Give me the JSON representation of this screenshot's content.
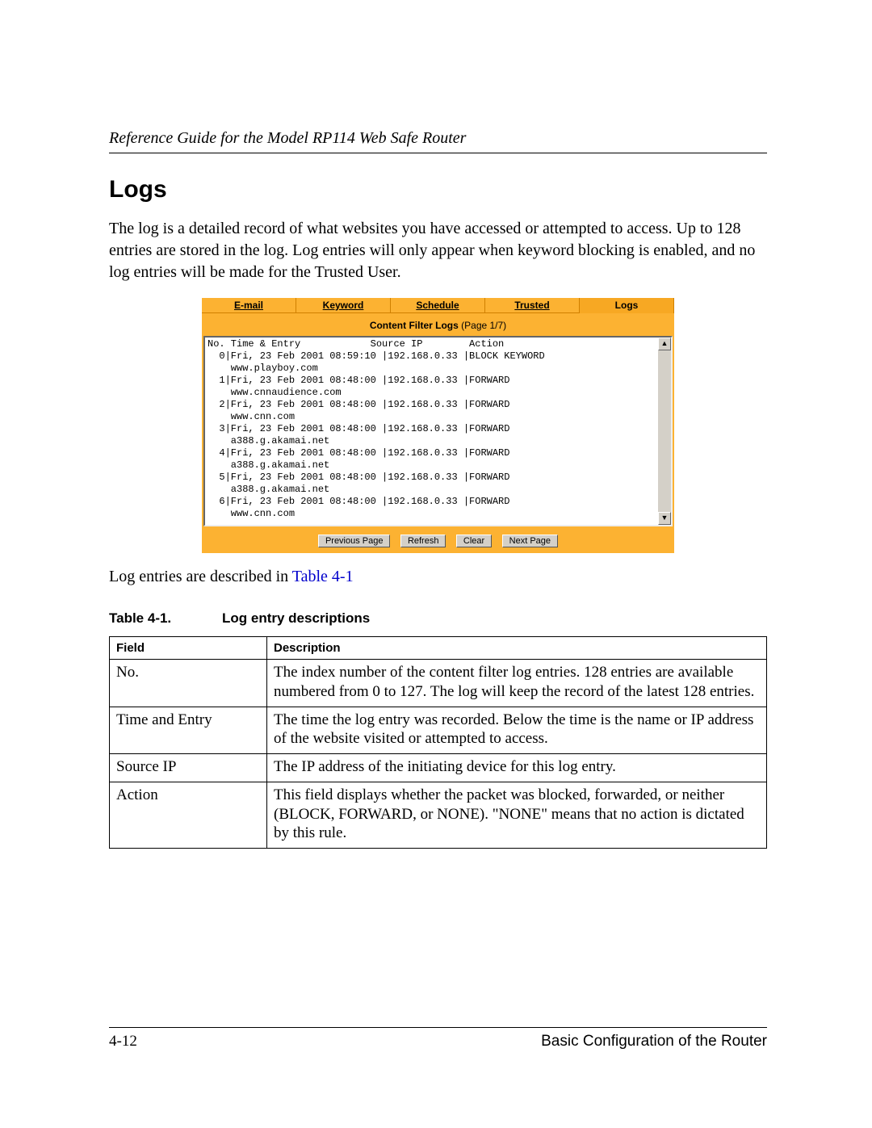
{
  "header": {
    "doc_title": "Reference Guide for the Model RP114 Web Safe Router"
  },
  "section": {
    "heading": "Logs",
    "intro": "The log is a detailed record of what websites you have accessed or attempted to access. Up to 128 entries are stored in the log. Log entries will only appear when keyword blocking is enabled, and no log entries will be made for the Trusted User."
  },
  "screenshot": {
    "tabs": [
      "E-mail",
      "Keyword",
      "Schedule",
      "Trusted",
      "Logs"
    ],
    "active_tab_index": 4,
    "title_bold": "Content Filter Logs ",
    "title_rest": "(Page 1/7)",
    "log_header": "No. Time & Entry            Source IP        Action",
    "log_entries": [
      {
        "no": 0,
        "time": "Fri, 23 Feb 2001 08:59:10",
        "ip": "192.168.0.33",
        "action": "BLOCK KEYWORD",
        "site": "www.playboy.com"
      },
      {
        "no": 1,
        "time": "Fri, 23 Feb 2001 08:48:00",
        "ip": "192.168.0.33",
        "action": "FORWARD",
        "site": "www.cnnaudience.com"
      },
      {
        "no": 2,
        "time": "Fri, 23 Feb 2001 08:48:00",
        "ip": "192.168.0.33",
        "action": "FORWARD",
        "site": "www.cnn.com"
      },
      {
        "no": 3,
        "time": "Fri, 23 Feb 2001 08:48:00",
        "ip": "192.168.0.33",
        "action": "FORWARD",
        "site": "a388.g.akamai.net"
      },
      {
        "no": 4,
        "time": "Fri, 23 Feb 2001 08:48:00",
        "ip": "192.168.0.33",
        "action": "FORWARD",
        "site": "a388.g.akamai.net"
      },
      {
        "no": 5,
        "time": "Fri, 23 Feb 2001 08:48:00",
        "ip": "192.168.0.33",
        "action": "FORWARD",
        "site": "a388.g.akamai.net"
      },
      {
        "no": 6,
        "time": "Fri, 23 Feb 2001 08:48:00",
        "ip": "192.168.0.33",
        "action": "FORWARD",
        "site": "www.cnn.com"
      }
    ],
    "buttons": {
      "prev": "Previous Page",
      "refresh": "Refresh",
      "clear": "Clear",
      "next": "Next Page"
    }
  },
  "reference": {
    "prefix": "Log entries are described in ",
    "link": "Table 4-1"
  },
  "table": {
    "caption_num": "Table 4-1.",
    "caption_text": "Log entry descriptions",
    "headers": [
      "Field",
      "Description"
    ],
    "rows": [
      {
        "field": "No.",
        "desc": "The index number of the content filter log entries. 128 entries are available numbered from 0 to 127. The log will keep the record of the latest 128 entries."
      },
      {
        "field": "Time and Entry",
        "desc": "The time the log entry was recorded. Below the time is the name or IP address of the website visited or attempted to access."
      },
      {
        "field": "Source IP",
        "desc": "The IP address of the initiating device for this log entry."
      },
      {
        "field": "Action",
        "desc": "This field displays whether the packet was blocked, forwarded, or neither (BLOCK, FORWARD, or NONE). \"NONE\" means that no action is dictated by this rule."
      }
    ]
  },
  "footer": {
    "page_number": "4-12",
    "chapter": "Basic Configuration of the Router"
  }
}
